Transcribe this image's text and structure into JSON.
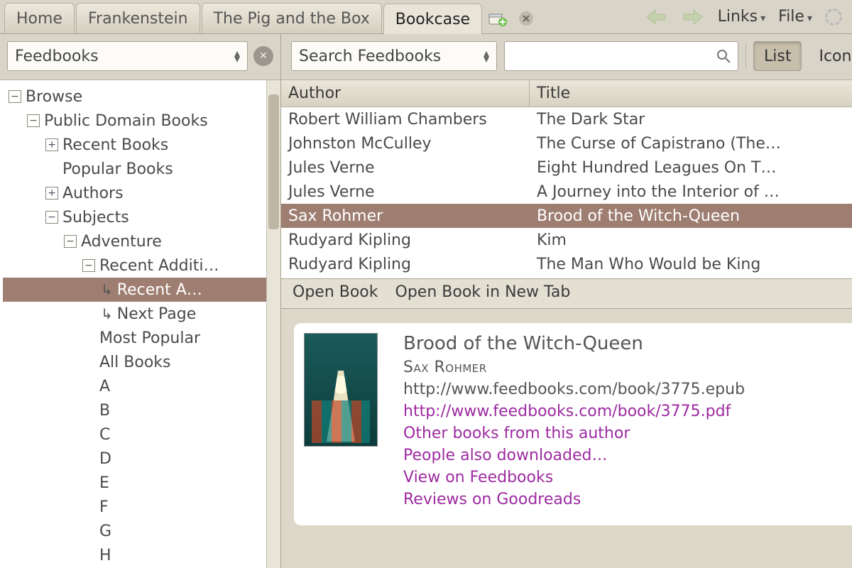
{
  "tabs": {
    "t0": "Home",
    "t1": "Frankenstein",
    "t2": "The Pig and the Box",
    "t3": "Bookcase"
  },
  "topbar": {
    "links": "Links",
    "file": "File"
  },
  "sidebar": {
    "source_combo": "Feedbooks",
    "tree": {
      "browse": "Browse",
      "public_domain": "Public Domain Books",
      "recent": "Recent Books",
      "popular": "Popular Books",
      "authors": "Authors",
      "subjects": "Subjects",
      "adventure": "Adventure",
      "recent_add": "Recent Additi…",
      "recent_a": "Recent A…",
      "next_page": "Next Page",
      "most_popular": "Most Popular",
      "all_books": "All Books",
      "A": "A",
      "B": "B",
      "C": "C",
      "D": "D",
      "E": "E",
      "F": "F",
      "G": "G",
      "H": "H"
    }
  },
  "toolbar": {
    "search_combo": "Search Feedbooks",
    "search_value": "",
    "list": "List",
    "icons": "Icons"
  },
  "table": {
    "col_author": "Author",
    "col_title": "Title",
    "rows": [
      {
        "author": "Robert William Chambers",
        "title": "The Dark Star"
      },
      {
        "author": "Johnston McCulley",
        "title": "The Curse of Capistrano (The…"
      },
      {
        "author": "Jules Verne",
        "title": "Eight Hundred Leagues On T…"
      },
      {
        "author": "Jules Verne",
        "title": "A Journey into the Interior of …"
      },
      {
        "author": "Sax Rohmer",
        "title": "Brood of the Witch-Queen"
      },
      {
        "author": "Rudyard Kipling",
        "title": "Kim"
      },
      {
        "author": "Rudyard Kipling",
        "title": "The Man Who Would be King"
      }
    ]
  },
  "actions": {
    "open": "Open Book",
    "open_new": "Open Book in New Tab"
  },
  "detail": {
    "title": "Brood of the Witch-Queen",
    "author": "Sax Rohmer",
    "url_epub": "http://www.feedbooks.com/book/3775.epub",
    "url_pdf": "http://www.feedbooks.com/book/3775.pdf",
    "link_other": "Other books from this author",
    "link_people": "People also downloaded…",
    "link_view": "View on Feedbooks",
    "link_reviews": "Reviews on Goodreads"
  }
}
